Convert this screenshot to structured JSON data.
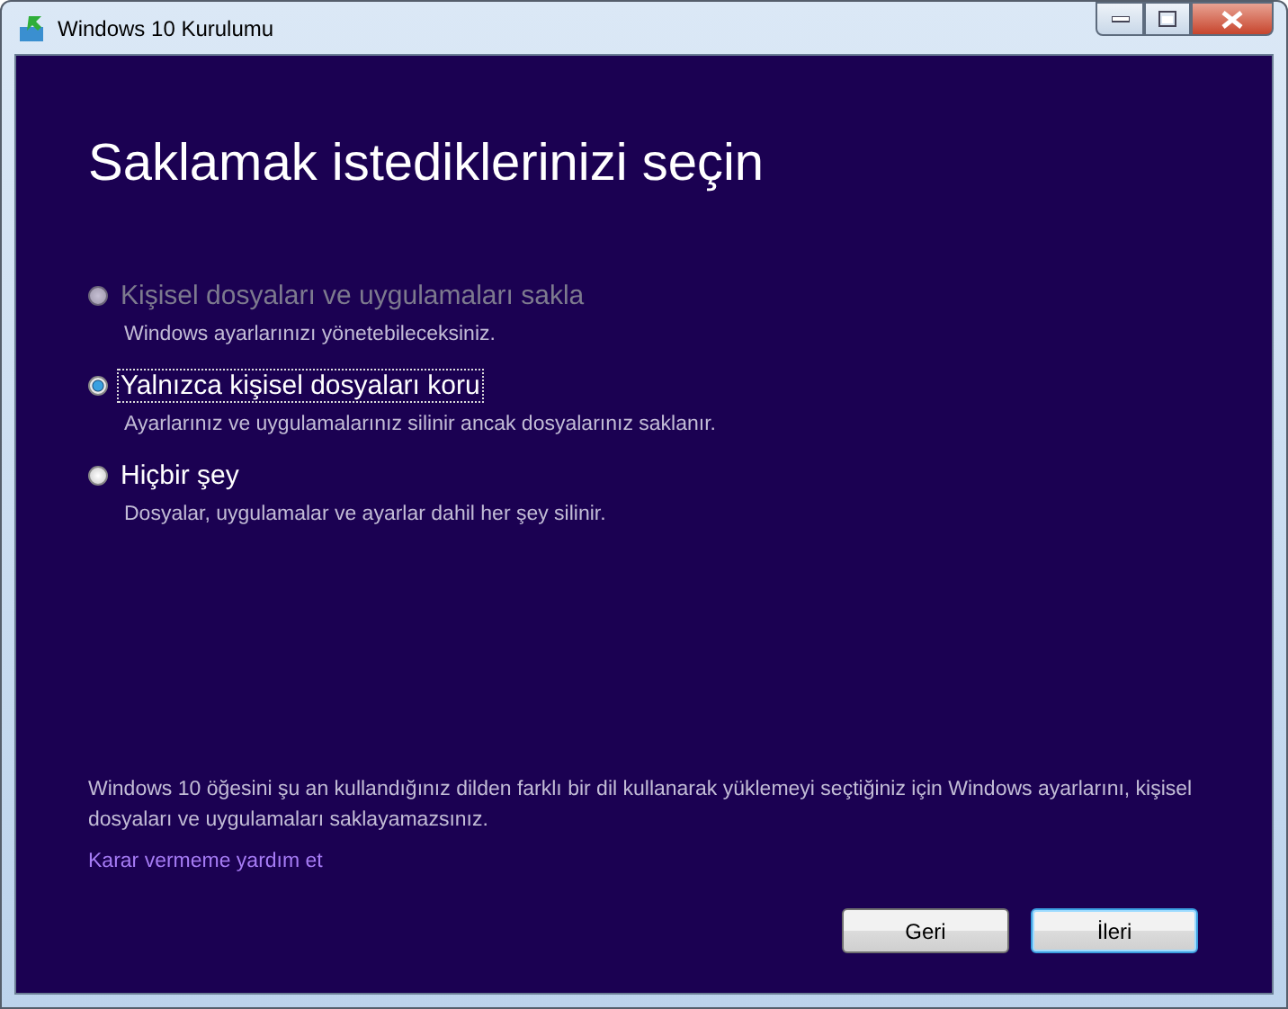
{
  "window": {
    "title": "Windows 10 Kurulumu"
  },
  "heading": "Saklamak istediklerinizi seçin",
  "options": [
    {
      "label": "Kişisel dosyaları ve uygulamaları sakla",
      "description": "Windows ayarlarınızı yönetebileceksiniz.",
      "selected": false,
      "disabled": true,
      "focused": false
    },
    {
      "label": "Yalnızca kişisel dosyaları koru",
      "description": "Ayarlarınız ve uygulamalarınız silinir ancak dosyalarınız saklanır.",
      "selected": true,
      "disabled": false,
      "focused": true
    },
    {
      "label": "Hiçbir şey",
      "description": "Dosyalar, uygulamalar ve ayarlar dahil her şey silinir.",
      "selected": false,
      "disabled": false,
      "focused": false
    }
  ],
  "notice": "Windows 10 öğesini şu an kullandığınız dilden farklı bir dil kullanarak yüklemeyi seçtiğiniz için Windows ayarlarını, kişisel dosyaları ve uygulamaları saklayamazsınız.",
  "help_link": "Karar vermeme yardım et",
  "buttons": [
    {
      "label": "Geri",
      "default": false
    },
    {
      "label": "İleri",
      "default": true
    }
  ]
}
